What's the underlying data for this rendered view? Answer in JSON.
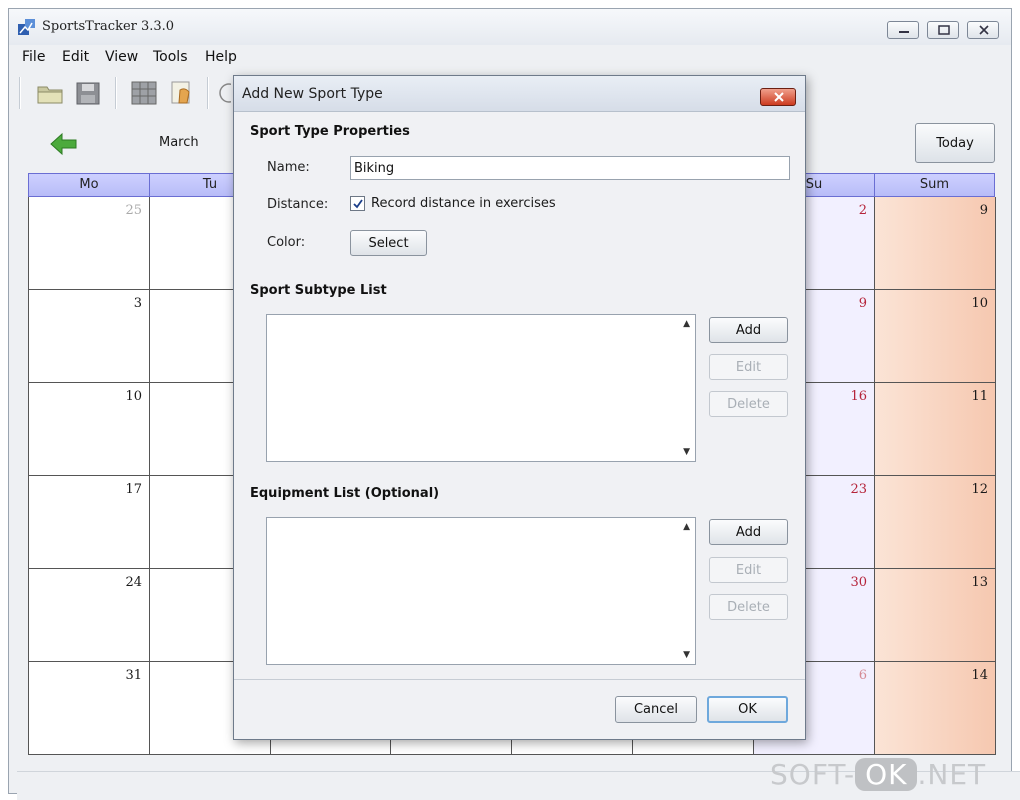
{
  "window": {
    "title": "SportsTracker 3.3.0",
    "menu": [
      "File",
      "Edit",
      "View",
      "Tools",
      "Help"
    ]
  },
  "toolbar": {
    "icons": [
      "open-folder-icon",
      "save-icon",
      "calendar-view-icon",
      "edit-entry-icon"
    ]
  },
  "calendar": {
    "month_label": "March",
    "today_label": "Today",
    "headers": [
      "Mo",
      "Tu",
      "",
      "",
      "",
      "",
      "Su",
      "Sum"
    ],
    "monday_numbers": [
      "25",
      "3",
      "10",
      "17",
      "24",
      "31"
    ],
    "sunday_numbers": [
      "2",
      "9",
      "16",
      "23",
      "30",
      "6"
    ],
    "sum_numbers": [
      "9",
      "10",
      "11",
      "12",
      "13",
      "14"
    ]
  },
  "dialog": {
    "title": "Add New Sport Type",
    "properties_title": "Sport Type Properties",
    "name_label": "Name:",
    "name_value": "Biking",
    "distance_label": "Distance:",
    "distance_checkbox_label": "Record distance in exercises",
    "distance_checked": true,
    "color_label": "Color:",
    "select_label": "Select",
    "subtype_title": "Sport Subtype List",
    "equipment_title": "Equipment List (Optional)",
    "add_label": "Add",
    "edit_label": "Edit",
    "delete_label": "Delete",
    "cancel_label": "Cancel",
    "ok_label": "OK"
  },
  "watermark": {
    "left": "SOFT-",
    "ok": "OK",
    "right": ".NET"
  }
}
